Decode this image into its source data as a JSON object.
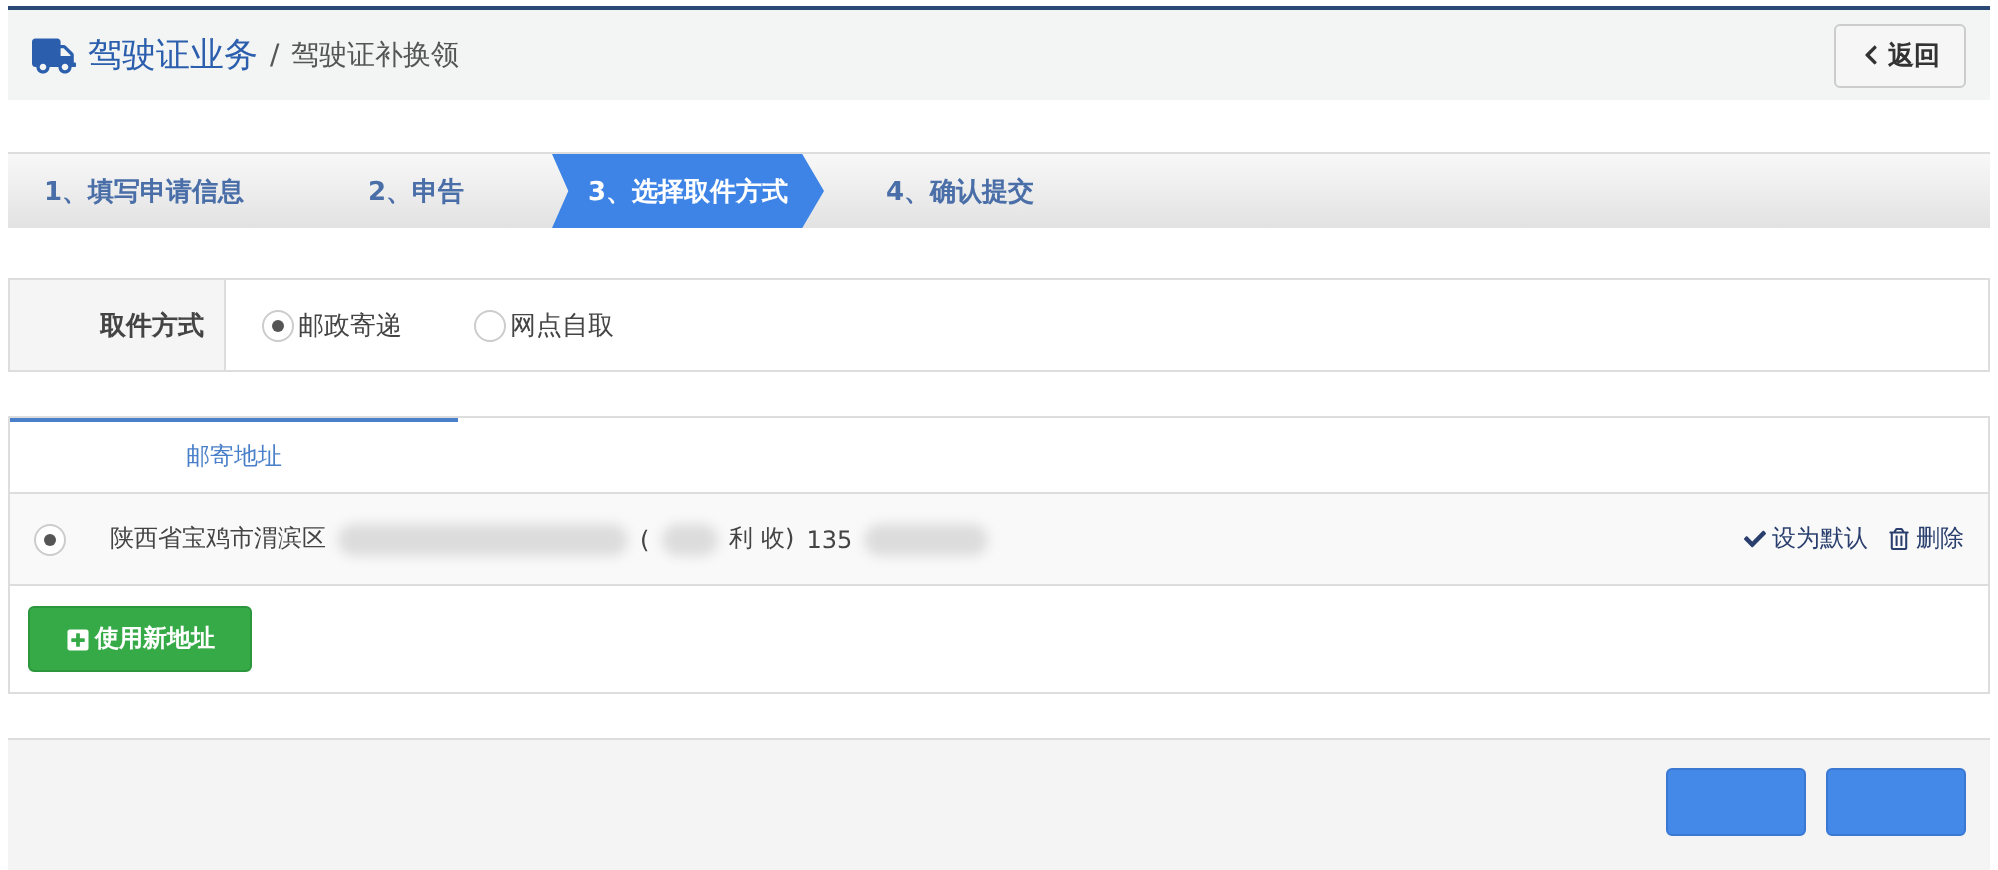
{
  "header": {
    "section": "驾驶证业务",
    "separator": "/",
    "page": "驾驶证补换领",
    "back_button": "返回"
  },
  "steps": [
    {
      "label": "1、填写申请信息",
      "selected": false
    },
    {
      "label": "2、申告",
      "selected": false
    },
    {
      "label": "3、选择取件方式",
      "selected": true
    },
    {
      "label": "4、确认提交",
      "selected": false
    }
  ],
  "pickup": {
    "label": "取件方式",
    "options": [
      {
        "label": "邮政寄递",
        "selected": true
      },
      {
        "label": "网点自取",
        "selected": false
      }
    ]
  },
  "address_panel": {
    "tab": "邮寄地址",
    "addresses": [
      {
        "selected": true,
        "parts": [
          {
            "kind": "text",
            "text": "陕西省宝鸡市渭滨区"
          },
          {
            "kind": "blur"
          },
          {
            "kind": "text",
            "text": "("
          },
          {
            "kind": "blur"
          },
          {
            "kind": "text",
            "text": "利 收)"
          },
          {
            "kind": "text",
            "text": "135"
          },
          {
            "kind": "blur"
          }
        ],
        "set_default": "设为默认",
        "delete": "删除"
      }
    ],
    "new_address_button": "使用新地址"
  },
  "footer": {
    "buttons": [
      {
        "kind": "blank"
      },
      {
        "kind": "blank"
      }
    ]
  }
}
